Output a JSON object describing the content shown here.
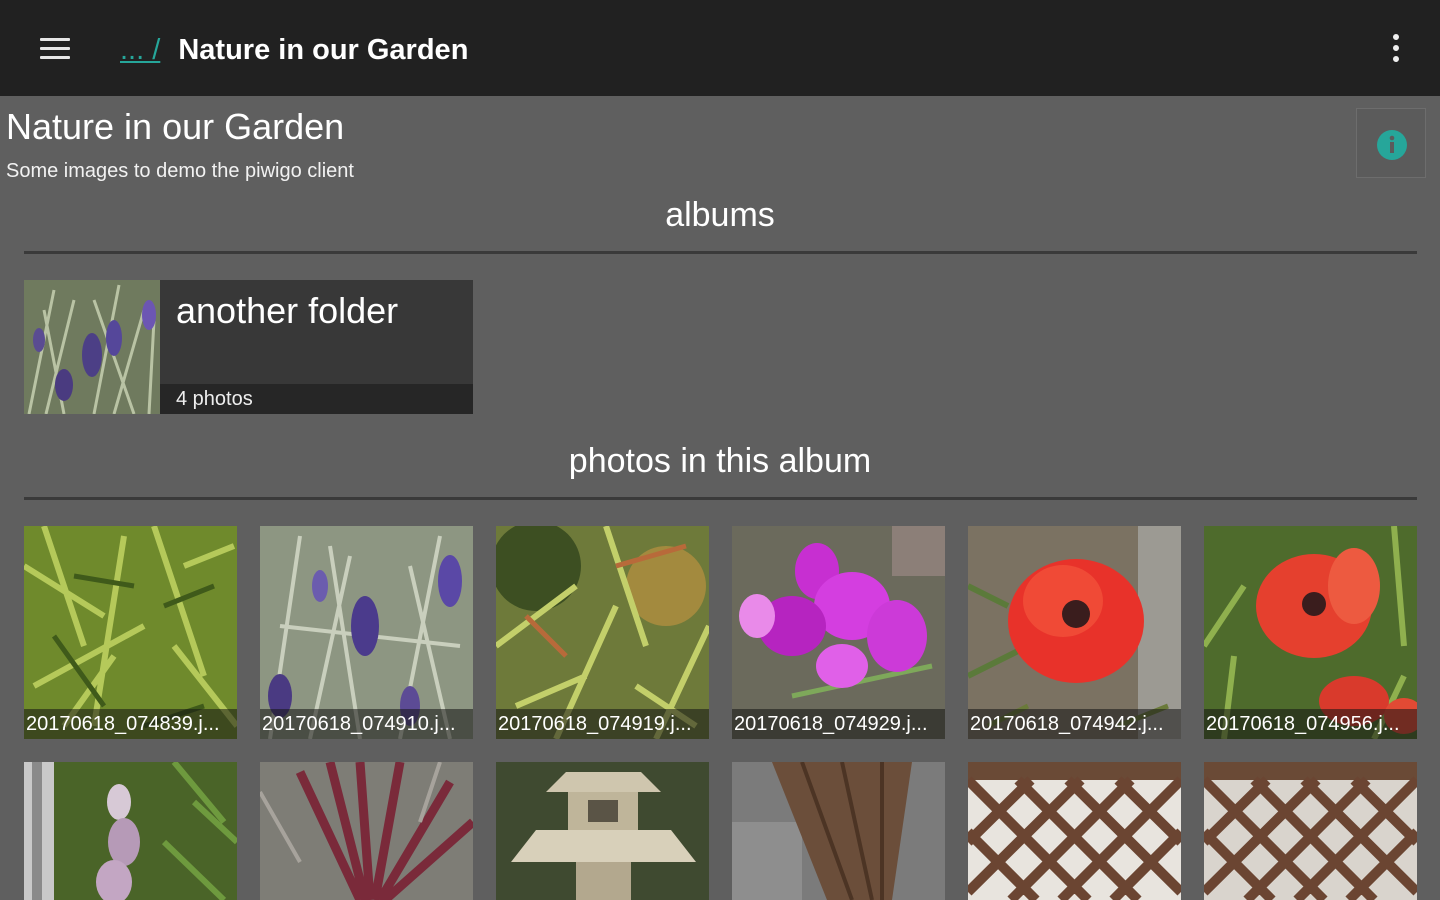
{
  "appbar": {
    "breadcrumb_parent": "... /",
    "breadcrumb_current": "Nature in our Garden"
  },
  "album": {
    "title": "Nature in our Garden",
    "description": "Some images to demo the piwigo client"
  },
  "sections": {
    "albums_heading": "albums",
    "photos_heading": "photos in this album"
  },
  "subalbums": [
    {
      "name": "another folder",
      "count": "4 photos"
    }
  ],
  "photos": [
    {
      "caption": "20170618_074839.j..."
    },
    {
      "caption": "20170618_074910.j..."
    },
    {
      "caption": "20170618_074919.j..."
    },
    {
      "caption": "20170618_074929.j..."
    },
    {
      "caption": "20170618_074942.j..."
    },
    {
      "caption": "20170618_074956.j..."
    }
  ],
  "colors": {
    "appbar": "#212121",
    "background": "#5f5f5f",
    "accent": "#26a69a"
  },
  "icons": [
    "hamburger-menu-icon",
    "overflow-menu-icon",
    "info-icon"
  ]
}
